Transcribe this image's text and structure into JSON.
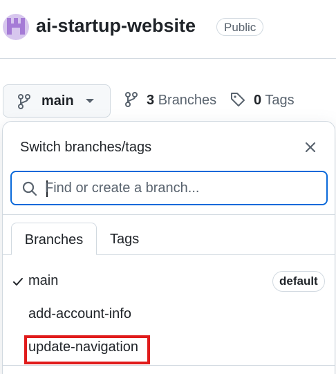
{
  "repo": {
    "name": "ai-startup-website",
    "visibility": "Public",
    "avatar_icon": "octocat-avatar-icon"
  },
  "toolbar": {
    "current_branch": "main",
    "branch_icon": "git-branch-icon",
    "branches_count": "3",
    "branches_label": "Branches",
    "tags_count": "0",
    "tags_label": "Tags"
  },
  "dropdown": {
    "title": "Switch branches/tags",
    "search_placeholder": "Find or create a branch...",
    "search_value": "",
    "tabs": [
      {
        "label": "Branches",
        "selected": true
      },
      {
        "label": "Tags",
        "selected": false
      }
    ],
    "branches": [
      {
        "name": "main",
        "checked": true,
        "badge": "default"
      },
      {
        "name": "add-account-info",
        "checked": false,
        "badge": ""
      },
      {
        "name": "update-navigation",
        "checked": false,
        "badge": "",
        "highlighted": true
      }
    ]
  },
  "colors": {
    "accent_blue": "#0969da",
    "highlight_red": "#e01b1b",
    "avatar_purple": "#a57bd6",
    "border": "#d1d9e0"
  }
}
